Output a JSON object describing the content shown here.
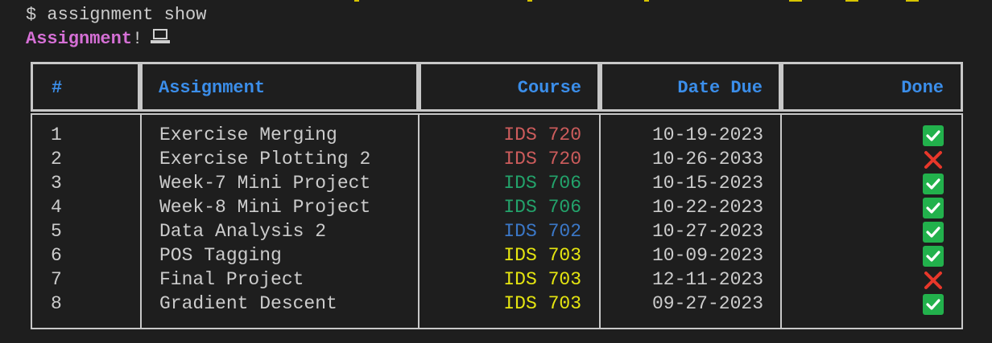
{
  "terminal": {
    "prompt": "$",
    "command": "assignment show",
    "title_word": "Assignment",
    "title_suffix": "!",
    "title_icon": "laptop-icon"
  },
  "table": {
    "headers": {
      "num": "#",
      "assignment": "Assignment",
      "course": "Course",
      "date_due": "Date Due",
      "done": "Done"
    },
    "rows": [
      {
        "num": "1",
        "assignment": "Exercise Merging",
        "course": "IDS 720",
        "date_due": "10-19-2023",
        "done": true
      },
      {
        "num": "2",
        "assignment": "Exercise Plotting 2",
        "course": "IDS 720",
        "date_due": "10-26-2033",
        "done": false
      },
      {
        "num": "3",
        "assignment": "Week-7 Mini Project",
        "course": "IDS 706",
        "date_due": "10-15-2023",
        "done": true
      },
      {
        "num": "4",
        "assignment": "Week-8 Mini Project",
        "course": "IDS 706",
        "date_due": "10-22-2023",
        "done": true
      },
      {
        "num": "5",
        "assignment": "Data Analysis 2",
        "course": "IDS 702",
        "date_due": "10-27-2023",
        "done": true
      },
      {
        "num": "6",
        "assignment": "POS Tagging",
        "course": "IDS 703",
        "date_due": "10-09-2023",
        "done": true
      },
      {
        "num": "7",
        "assignment": "Final Project",
        "course": "IDS 703",
        "date_due": "12-11-2023",
        "done": false
      },
      {
        "num": "8",
        "assignment": "Gradient Descent",
        "course": "IDS 703",
        "date_due": "09-27-2023",
        "done": true
      }
    ],
    "course_colors": {
      "IDS 720": "#cd5c5c",
      "IDS 706": "#23a36b",
      "IDS 702": "#3b78c8",
      "IDS 703": "#e5e510"
    },
    "header_color": "#3b8eea",
    "done_icon": "check-icon",
    "not_done_icon": "cross-icon"
  }
}
